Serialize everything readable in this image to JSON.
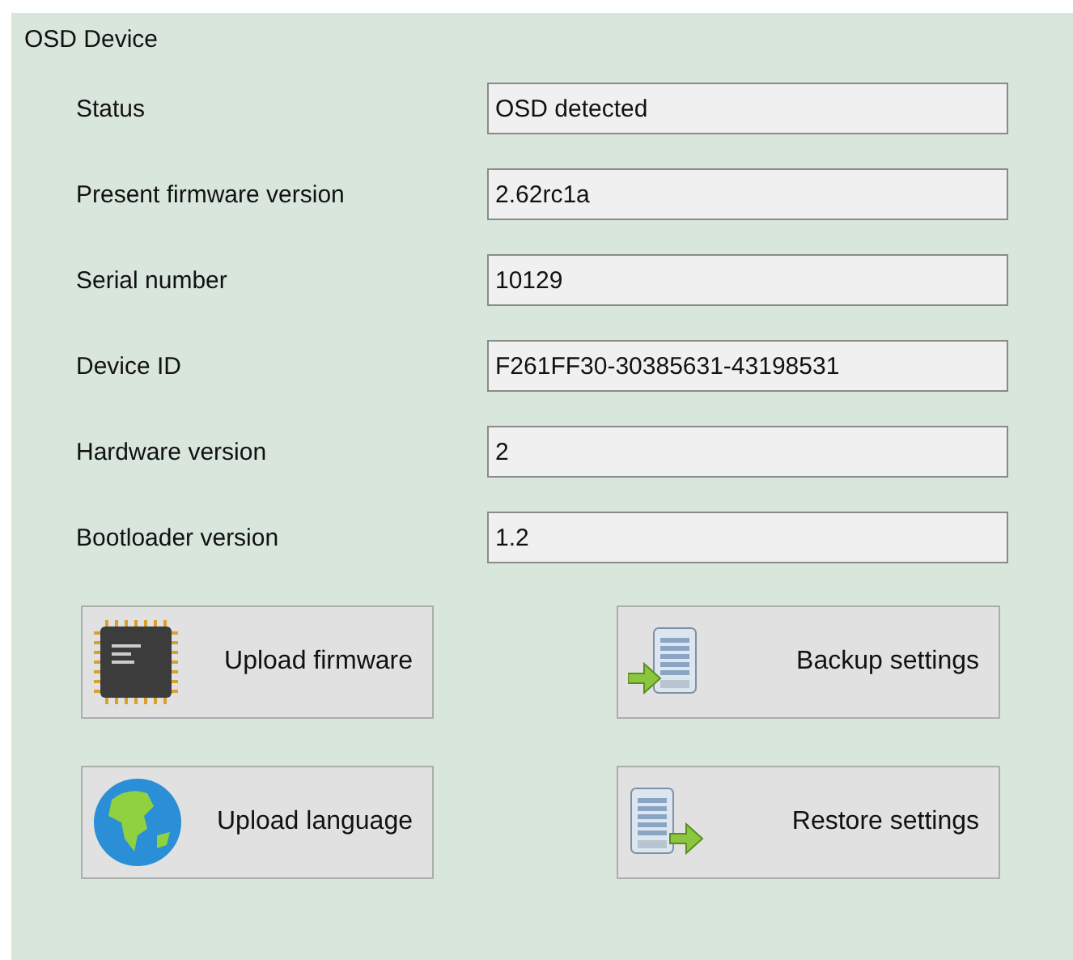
{
  "group": {
    "title": "OSD Device"
  },
  "fields": [
    {
      "label": "Status",
      "value": "OSD detected"
    },
    {
      "label": "Present firmware version",
      "value": "2.62rc1a"
    },
    {
      "label": "Serial number",
      "value": "10129"
    },
    {
      "label": "Device ID",
      "value": "F261FF30-30385631-43198531"
    },
    {
      "label": "Hardware version",
      "value": "2"
    },
    {
      "label": "Bootloader version",
      "value": "1.2"
    }
  ],
  "buttons": [
    {
      "label": "Upload firmware",
      "kind": "chip"
    },
    {
      "label": "Backup settings",
      "kind": "backup"
    },
    {
      "label": "Upload language",
      "kind": "globe"
    },
    {
      "label": "Restore settings",
      "kind": "restore"
    }
  ]
}
